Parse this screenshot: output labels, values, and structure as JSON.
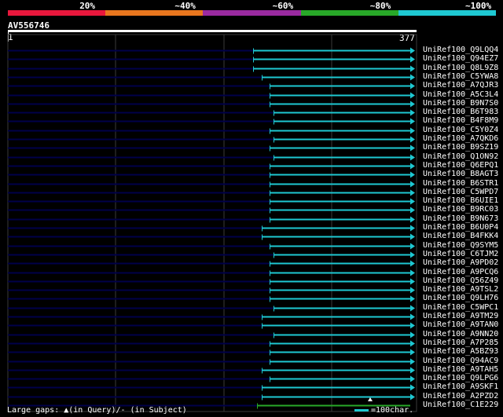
{
  "identity_scale": {
    "labels": [
      "20%",
      "~40%",
      "~60%",
      "~80%",
      "~100%"
    ],
    "colors": [
      "#e8173c",
      "#e8761e",
      "#9a2aa0",
      "#28a828",
      "#1ec8d2"
    ]
  },
  "query": {
    "name": "AV556746",
    "start": "1",
    "end": "377"
  },
  "colors": {
    "query_line": "#00004a",
    "hit_bar": "#1ec8d2",
    "hit_bar_last": "#28a828",
    "grid": "#3a3a3a"
  },
  "hits": [
    {
      "name": "UniRef100_Q9LQQ4",
      "start": 0.61
    },
    {
      "name": "UniRef100_Q94EZ7",
      "start": 0.61
    },
    {
      "name": "UniRef100_Q8L9Z8",
      "start": 0.61
    },
    {
      "name": "UniRef100_C5YWA8",
      "start": 0.63
    },
    {
      "name": "UniRef100_A7QJR3",
      "start": 0.65
    },
    {
      "name": "UniRef100_A5C3L4",
      "start": 0.65
    },
    {
      "name": "UniRef100_B9N7S0",
      "start": 0.65
    },
    {
      "name": "UniRef100_B6T983",
      "start": 0.66
    },
    {
      "name": "UniRef100_B4F8M9",
      "start": 0.66
    },
    {
      "name": "UniRef100_C5Y0Z4",
      "start": 0.65
    },
    {
      "name": "UniRef100_A7QKD6",
      "start": 0.66
    },
    {
      "name": "UniRef100_B9SZ19",
      "start": 0.65
    },
    {
      "name": "UniRef100_Q1ON92",
      "start": 0.66
    },
    {
      "name": "UniRef100_Q6EPQ1",
      "start": 0.65
    },
    {
      "name": "UniRef100_B8AGT3",
      "start": 0.65
    },
    {
      "name": "UniRef100_B6STR1",
      "start": 0.65
    },
    {
      "name": "UniRef100_C5WPD7",
      "start": 0.65
    },
    {
      "name": "UniRef100_B6UIE1",
      "start": 0.65
    },
    {
      "name": "UniRef100_B9RC03",
      "start": 0.65
    },
    {
      "name": "UniRef100_B9N673",
      "start": 0.65
    },
    {
      "name": "UniRef100_B6U0P4",
      "start": 0.63
    },
    {
      "name": "UniRef100_B4FKK4",
      "start": 0.63
    },
    {
      "name": "UniRef100_Q9SYM5",
      "start": 0.65
    },
    {
      "name": "UniRef100_C6TJM2",
      "start": 0.66
    },
    {
      "name": "UniRef100_A9PD02",
      "start": 0.65
    },
    {
      "name": "UniRef100_A9PCQ6",
      "start": 0.65
    },
    {
      "name": "UniRef100_Q56Z49",
      "start": 0.65
    },
    {
      "name": "UniRef100_A9TSL2",
      "start": 0.65
    },
    {
      "name": "UniRef100_Q9LH76",
      "start": 0.65
    },
    {
      "name": "UniRef100_C5WPC1",
      "start": 0.66
    },
    {
      "name": "UniRef100_A9TM29",
      "start": 0.63
    },
    {
      "name": "UniRef100_A9TAN0",
      "start": 0.63
    },
    {
      "name": "UniRef100_A9NN20",
      "start": 0.66
    },
    {
      "name": "UniRef100_A7P285",
      "start": 0.65
    },
    {
      "name": "UniRef100_A5BZ93",
      "start": 0.65
    },
    {
      "name": "UniRef100_Q94AC9",
      "start": 0.65
    },
    {
      "name": "UniRef100_A9TAH5",
      "start": 0.63
    },
    {
      "name": "UniRef100_Q9LPG6",
      "start": 0.65
    },
    {
      "name": "UniRef100_A9SKF1",
      "start": 0.63
    },
    {
      "name": "UniRef100_A2PZD2",
      "start": 0.63
    },
    {
      "name": "UniRef100_C1E229",
      "start": 0.62
    }
  ],
  "footer": {
    "gaps_text": "Large gaps: ▲(in Query)/- (in Subject)",
    "legend_text": "=100char."
  }
}
